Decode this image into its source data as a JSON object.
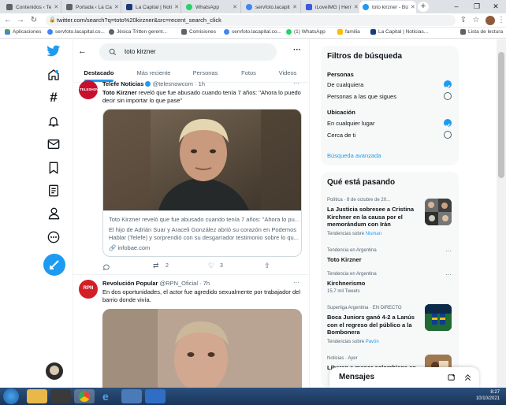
{
  "browser": {
    "tabs": [
      {
        "title": "Contenidos ‹ Te",
        "color": "#5f6368"
      },
      {
        "title": "Portada ‹ La Ca",
        "color": "#5f6368"
      },
      {
        "title": "La Capital | Noti",
        "color": "#1a3a7a"
      },
      {
        "title": "WhatsApp",
        "color": "#25d366"
      },
      {
        "title": "servfoto.lacapit",
        "color": "#4285f4"
      },
      {
        "title": "iLoveIMG | Herr",
        "color": "#3b5bdb"
      },
      {
        "title": "toto kirzner - Bú",
        "color": "#1d9bf0"
      }
    ],
    "url": "twitter.com/search?q=toto%20kirzner&src=recent_search_click",
    "bookmarks": [
      "Aplicaciones",
      "servfoto.lacapital.co...",
      "Jésica Tritten gerent...",
      "Comisiones",
      "servfoto.lacapital.co...",
      "(1) WhatsApp",
      "familia",
      "La Capital | Noticias...",
      "Lista de lectura"
    ]
  },
  "search": {
    "query": "toto kirzner",
    "tabs": [
      "Destacado",
      "Más reciente",
      "Personas",
      "Fotos",
      "Videos"
    ]
  },
  "tweets": [
    {
      "author": "Telefe Noticias",
      "handle": "@telesnowcom",
      "time": "1h",
      "text_bold": "Toto Kirzner",
      "text": " reveló que fue abusado cuando tenía 7 años: \"Ahora lo puedo decir sin importar lo que pase\"",
      "card_title": "Toto Kirzner reveló que fue abusado cuando tenía 7 años: \"Ahora lo pu...",
      "card_desc": "El hijo de Adrián Suar y Araceli González abrió su corazón en Podemos Hablar (Telefe) y sorprendió con su desgarrador testimonio sobre lo qu...",
      "card_domain": "infobae.com",
      "retweets": "2",
      "likes": "3"
    },
    {
      "author": "Revolución Popular",
      "handle": "@RPN_Oficial",
      "time": "7h",
      "text": "En dos oportunidades, el actor fue agredido sexualmente por trabajador del barrio donde vivía."
    }
  ],
  "filters": {
    "title": "Filtros de búsqueda",
    "people_label": "Personas",
    "people_options": [
      "De cualquiera",
      "Personas a las que sigues"
    ],
    "location_label": "Ubicación",
    "location_options": [
      "En cualquier lugar",
      "Cerca de ti"
    ],
    "advanced": "Búsqueda avanzada"
  },
  "trends": {
    "title": "Qué está pasando",
    "items": [
      {
        "meta": "Política · 8 de octubre de 20...",
        "title": "La Justicia sobresee a Cristina Kirchner en la causa por el memorándum con Irán",
        "sub": "Tendencias sobre ",
        "sub_link": "Nisman"
      },
      {
        "meta": "Tendencia en Argentina",
        "title": "Toto Kirzner"
      },
      {
        "meta": "Tendencia en Argentina",
        "title": "Kirchnerismo",
        "sub": "15,7 mil Tweets"
      },
      {
        "meta": "Superliga Argentina · EN DIRECTO",
        "title": "Boca Juniors ganó 4-2 a Lanús con el regreso del público a la Bombonera",
        "sub": "Tendencias sobre ",
        "sub_link": "Pavón"
      },
      {
        "meta": "Noticias · Ayer",
        "title": "Liberan a menor colombiana en"
      }
    ]
  },
  "messages": {
    "label": "Mensajes"
  },
  "taskbar": {
    "time": "8:27",
    "date": "10/10/2021"
  },
  "colors": {
    "accent": "#1d9bf0"
  }
}
